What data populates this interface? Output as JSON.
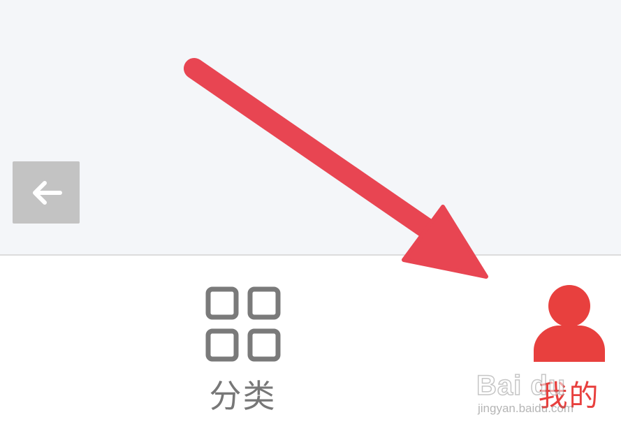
{
  "tab_bar": {
    "tabs": [
      {
        "label": "分类",
        "icon": "grid-icon",
        "active": false
      },
      {
        "label": "我的",
        "icon": "person-icon",
        "active": true
      }
    ]
  },
  "overlay": {
    "back_icon": "arrow-left-icon",
    "annotation": "red-pointer-arrow"
  },
  "watermark": {
    "brand": "Bai du",
    "site": "jingyan.baidu.com"
  },
  "colors": {
    "accent": "#e8403e",
    "inactive": "#777777",
    "content_bg": "#f4f6f9",
    "arrow": "#e84552"
  }
}
